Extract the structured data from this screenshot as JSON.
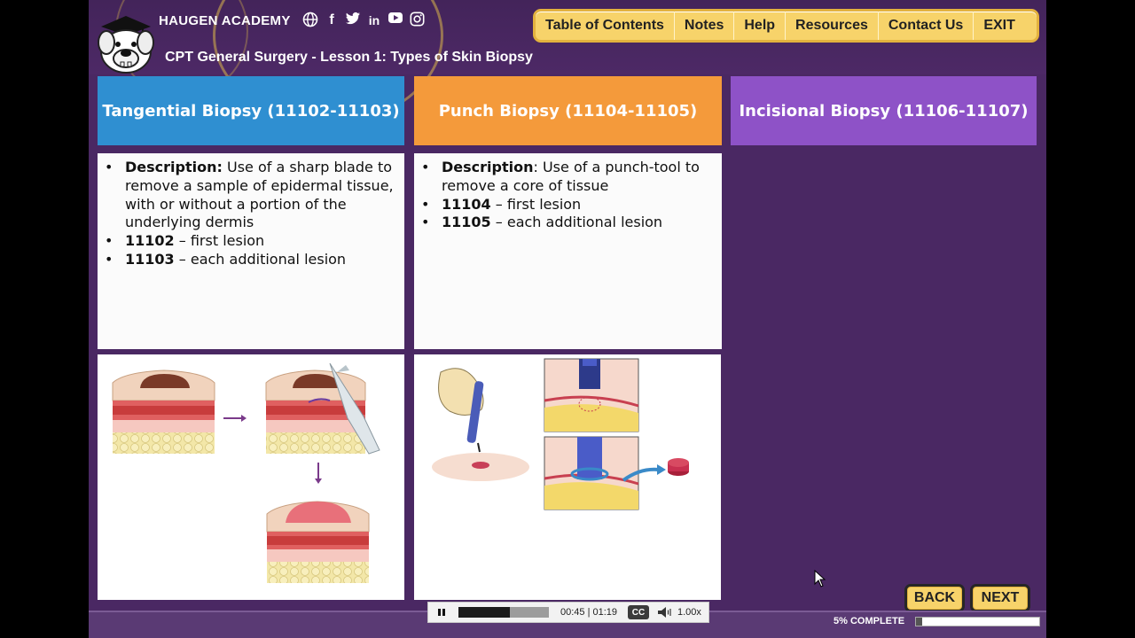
{
  "app": {
    "brand": "HAUGEN ACADEMY",
    "lesson_title": "CPT General Surgery - Lesson 1: Types of Skin Biopsy"
  },
  "social_icons": [
    "globe-icon",
    "facebook-icon",
    "twitter-icon",
    "linkedin-icon",
    "youtube-icon",
    "instagram-icon"
  ],
  "top_nav": {
    "items": [
      {
        "label": "Table of Contents"
      },
      {
        "label": "Notes"
      },
      {
        "label": "Help"
      },
      {
        "label": "Resources"
      },
      {
        "label": "Contact Us"
      },
      {
        "label": "EXIT"
      }
    ]
  },
  "columns": {
    "tangential": {
      "title": "Tangential Biopsy (11102-11103)",
      "desc_label": "Description:",
      "desc_text": " Use of a sharp blade to remove a sample of epidermal tissue, with or without a portion of the underlying dermis",
      "codes": [
        {
          "code": "11102",
          "text": " – first lesion"
        },
        {
          "code": "11103",
          "text": " – each additional lesion"
        }
      ]
    },
    "punch": {
      "title": "Punch Biopsy (11104-11105)",
      "desc_label": "Description",
      "desc_text": ": Use of a punch-tool to remove a core of tissue",
      "codes": [
        {
          "code": "11104",
          "text": " – first lesion"
        },
        {
          "code": "11105",
          "text": " – each additional lesion"
        }
      ]
    },
    "incisional": {
      "title": "Incisional Biopsy (11106-11107)"
    }
  },
  "buttons": {
    "back": "BACK",
    "next": "NEXT"
  },
  "player": {
    "time": "00:45 | 01:19",
    "cc": "CC",
    "speed": "1.00x",
    "played_fraction": 0.57
  },
  "progress": {
    "label": "5% COMPLETE",
    "percent": 5
  },
  "colors": {
    "background": "#4a2863",
    "tangential": "#2f8fd1",
    "punch": "#f49a3b",
    "incisional": "#8e52c7",
    "nav_yellow": "#f7d36a"
  }
}
